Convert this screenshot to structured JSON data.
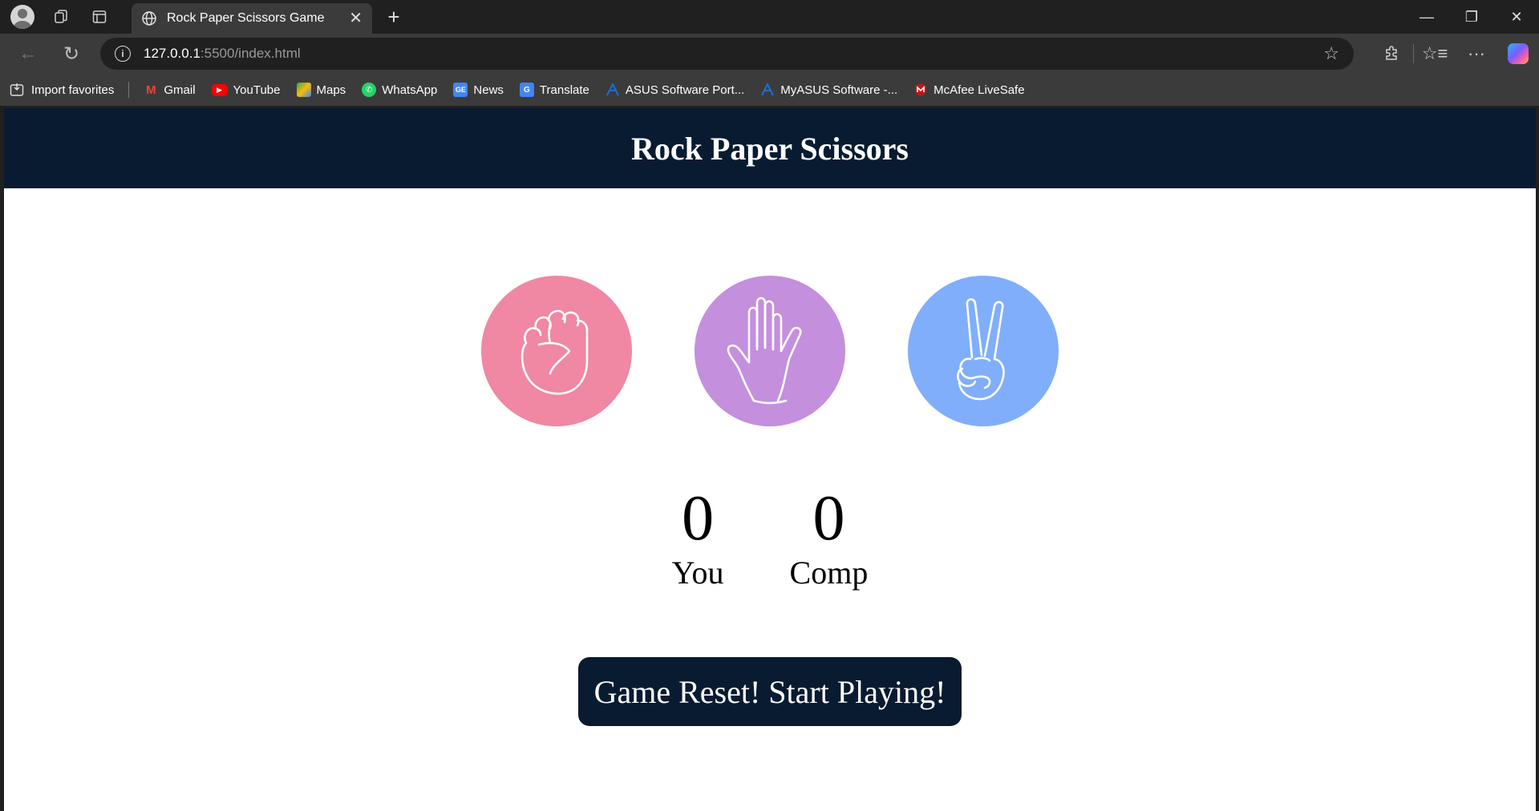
{
  "browser": {
    "tab": {
      "title": "Rock Paper Scissors Game"
    },
    "address": {
      "host": "127.0.0.1",
      "path": ":5500/index.html"
    },
    "bookmarks": [
      {
        "label": "Import favorites",
        "icon": "import-icon"
      },
      {
        "label": "Gmail",
        "icon": "gmail-icon",
        "color": "#ea4335"
      },
      {
        "label": "YouTube",
        "icon": "youtube-icon",
        "color": "#ff0000"
      },
      {
        "label": "Maps",
        "icon": "maps-icon",
        "color": "#34a853"
      },
      {
        "label": "WhatsApp",
        "icon": "whatsapp-icon",
        "color": "#25d366"
      },
      {
        "label": "News",
        "icon": "news-icon",
        "color": "#4285f4"
      },
      {
        "label": "Translate",
        "icon": "translate-icon",
        "color": "#4285f4"
      },
      {
        "label": "ASUS Software Port...",
        "icon": "asus-icon",
        "color": "#1a73e8"
      },
      {
        "label": "MyASUS Software -...",
        "icon": "asus-icon",
        "color": "#1a73e8"
      },
      {
        "label": "McAfee LiveSafe",
        "icon": "mcafee-icon",
        "color": "#c01818"
      }
    ]
  },
  "page": {
    "title": "Rock Paper Scissors",
    "header_color": "#081b31",
    "choices": [
      {
        "name": "rock",
        "icon": "rock-fist-icon",
        "color": "#f087a3"
      },
      {
        "name": "paper",
        "icon": "paper-hand-icon",
        "color": "#c48fdd"
      },
      {
        "name": "scissors",
        "icon": "scissors-peace-icon",
        "color": "#80aefa"
      }
    ],
    "scores": {
      "user": {
        "value": "0",
        "label": "You"
      },
      "comp": {
        "value": "0",
        "label": "Comp"
      }
    },
    "message": "Game Reset! Start Playing!"
  }
}
